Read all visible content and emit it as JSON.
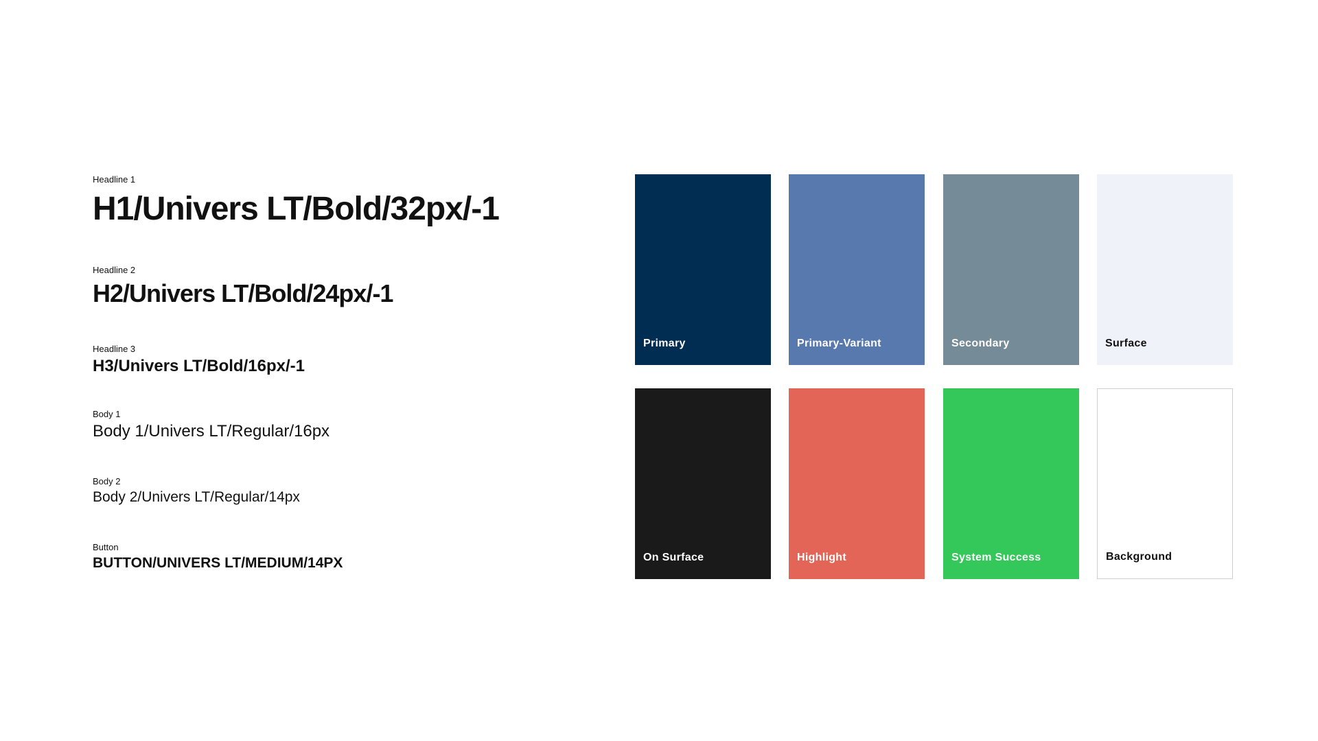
{
  "typography": [
    {
      "label": "Headline 1",
      "sample": "H1/Univers LT/Bold/32px/-1"
    },
    {
      "label": "Headline 2",
      "sample": "H2/Univers LT/Bold/24px/-1"
    },
    {
      "label": "Headline 3",
      "sample": "H3/Univers LT/Bold/16px/-1"
    },
    {
      "label": "Body 1",
      "sample": "Body 1/Univers LT/Regular/16px"
    },
    {
      "label": "Body 2",
      "sample": "Body 2/Univers LT/Regular/14px"
    },
    {
      "label": "Button",
      "sample": "BUTTON/UNIVERS LT/MEDIUM/14PX"
    }
  ],
  "colors": [
    {
      "name": "Primary",
      "hex": "#022d52",
      "text": "#ffffff"
    },
    {
      "name": "Primary-Variant",
      "hex": "#5779ae",
      "text": "#ffffff"
    },
    {
      "name": "Secondary",
      "hex": "#768b98",
      "text": "#ffffff"
    },
    {
      "name": "Surface",
      "hex": "#f0f2f9",
      "text": "#111111"
    },
    {
      "name": "On Surface",
      "hex": "#1a1a1a",
      "text": "#ffffff"
    },
    {
      "name": "Highlight",
      "hex": "#e26557",
      "text": "#ffffff"
    },
    {
      "name": "System Success",
      "hex": "#34c759",
      "text": "#ffffff"
    },
    {
      "name": "Background",
      "hex": "#ffffff",
      "text": "#111111"
    }
  ]
}
